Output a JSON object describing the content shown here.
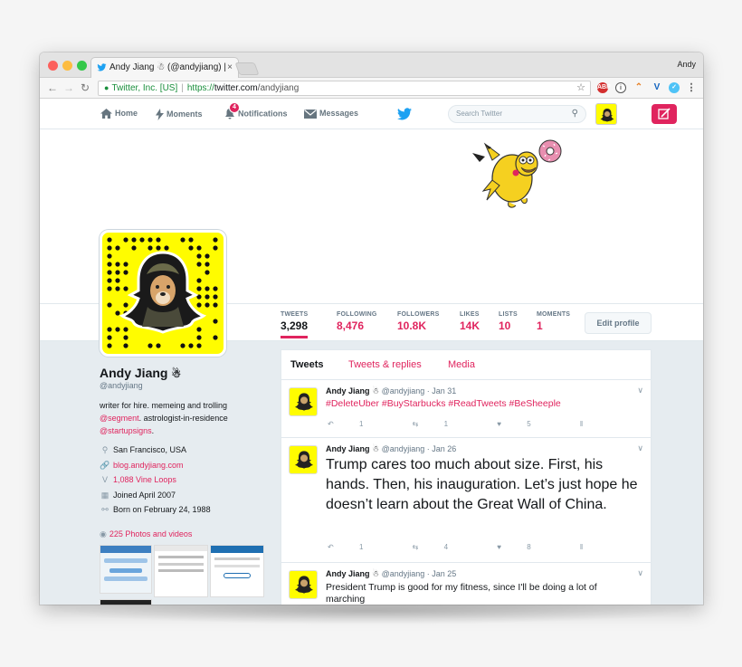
{
  "browser": {
    "tab_title": "Andy Jiang ☃ (@andyjiang) |",
    "tab_close": "×",
    "user": "Andy",
    "security_label": "Twitter, Inc. [US]",
    "url_protocol": "https://",
    "url_host": "twitter.com",
    "url_path": "/andyjiang"
  },
  "nav": {
    "home": "Home",
    "moments": "Moments",
    "notifications": "Notifications",
    "notifications_badge": "4",
    "messages": "Messages",
    "search_placeholder": "Search Twitter"
  },
  "stats": [
    {
      "label": "TWEETS",
      "value": "3,298"
    },
    {
      "label": "FOLLOWING",
      "value": "8,476"
    },
    {
      "label": "FOLLOWERS",
      "value": "10.8K"
    },
    {
      "label": "LIKES",
      "value": "14K"
    },
    {
      "label": "LISTS",
      "value": "10"
    },
    {
      "label": "MOMENTS",
      "value": "1"
    }
  ],
  "edit_profile": "Edit profile",
  "profile": {
    "name": "Andy Jiang",
    "name_emoji": "☃",
    "handle": "@andyjiang",
    "bio_1": "writer for hire. memeing and trolling",
    "bio_link_1": "@segment",
    "bio_2": ". astrologist-in-residence",
    "bio_link_2": "@startupsigns",
    "bio_3": ".",
    "location": "San Francisco, USA",
    "website": "blog.andyjiang.com",
    "vine": "1,088 Vine Loops",
    "joined": "Joined April 2007",
    "born": "Born on February 24, 1988",
    "photos": "225 Photos and videos"
  },
  "timeline_tabs": [
    "Tweets",
    "Tweets & replies",
    "Media"
  ],
  "tweets": [
    {
      "name": "Andy Jiang",
      "emoji": "☃",
      "handle": "@andyjiang · Jan 31",
      "text": "#DeleteUber #BuyStarbucks #ReadTweets #BeSheeple",
      "replies": "1",
      "retweets": "1",
      "likes": "5"
    },
    {
      "name": "Andy Jiang",
      "emoji": "☃",
      "handle": "@andyjiang · Jan 26",
      "text": "Trump cares too much about size. First, his hands. Then, his inauguration. Let’s just hope he doesn’t learn about the Great Wall of China.",
      "replies": "1",
      "retweets": "4",
      "likes": "8"
    },
    {
      "name": "Andy Jiang",
      "emoji": "☃",
      "handle": "@andyjiang · Jan 25",
      "text": "President Trump is good for my fitness, since I'll be doing a lot of marching"
    }
  ],
  "colors": {
    "accent": "#e0245e",
    "twitter_blue": "#1da1f2",
    "snap_yellow": "#fffc00"
  }
}
